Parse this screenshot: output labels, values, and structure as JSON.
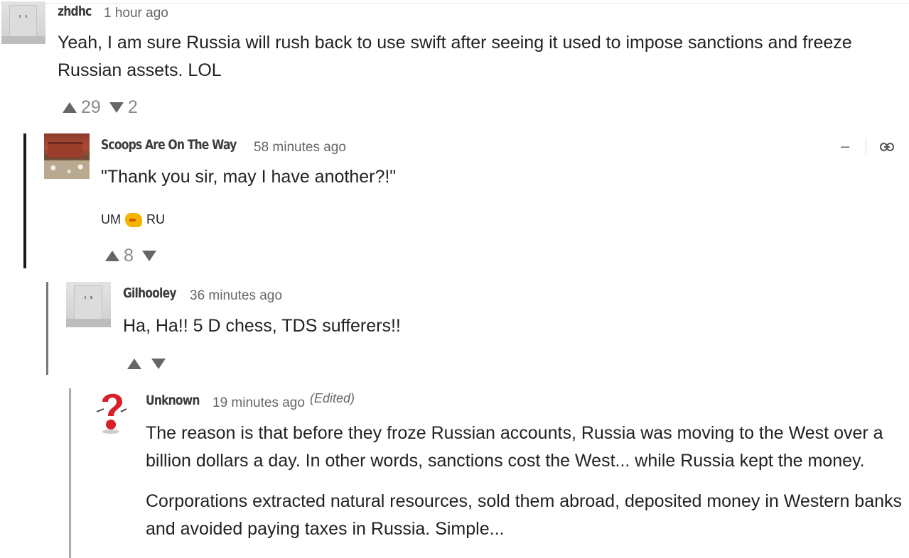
{
  "comments": [
    {
      "author": "zhdhc",
      "time": "1 hour ago",
      "paragraphs": [
        "Yeah, I am sure Russia will rush back to use swift after seeing it used to impose sanctions and freeze Russian assets. LOL"
      ],
      "upvotes": "29",
      "downvotes": "2"
    },
    {
      "author": "Scoops Are On The Way",
      "time": "58 minutes ago",
      "paragraphs": [
        "\"Thank you sir, may I have another?!\""
      ],
      "flag_left": "UM",
      "flag_right": "RU",
      "upvotes": "8",
      "downvotes": "",
      "collapse_label": "–"
    },
    {
      "author": "Gilhooley",
      "time": "36 minutes ago",
      "paragraphs": [
        "Ha, Ha!! 5 D chess, TDS sufferers!!"
      ],
      "upvotes": "",
      "downvotes": ""
    },
    {
      "author": "Unknown",
      "time": "19 minutes ago",
      "edited": "(Edited)",
      "paragraphs": [
        "The reason is that before they froze Russian accounts, Russia was moving to the West over a billion dollars a day. In other words, sanctions cost the West... while Russia kept the money.",
        "Corporations extracted natural resources, sold them abroad, deposited money in Western banks and avoided paying taxes in Russia. Simple..."
      ]
    }
  ],
  "colors": {
    "thread_line_1": "#1a1a1a",
    "thread_line_2": "#777777",
    "thread_line_3": "#aaaaaa",
    "vote_arrow": "#666666"
  },
  "icons": {
    "link": "link-icon",
    "collapse": "collapse-icon",
    "fist": "oncoming-fist-emoji"
  }
}
